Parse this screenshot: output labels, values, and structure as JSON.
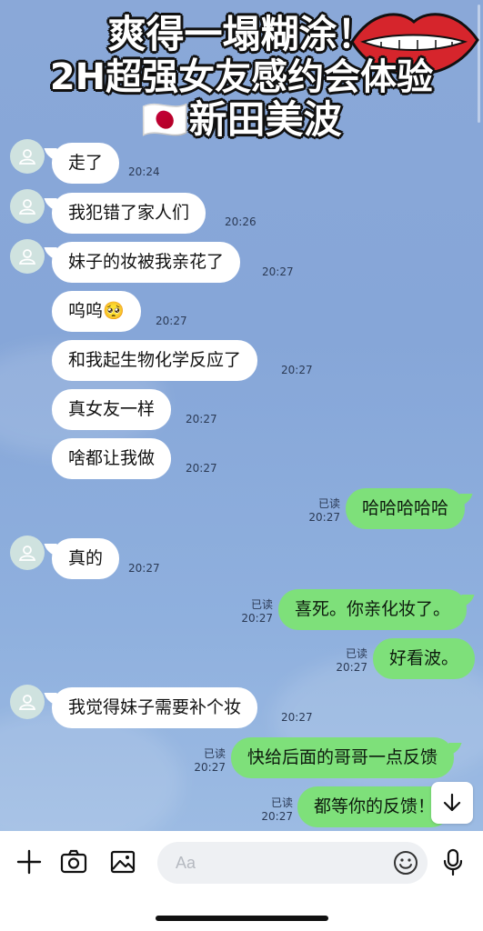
{
  "overlay": {
    "line1": "爽得一塌糊涂！",
    "line2": "2H超强女友感约会体验",
    "line3_flag": "🇯🇵",
    "line3": "新田美波"
  },
  "messages": [
    {
      "side": "in",
      "text": "走了",
      "time": "20:24"
    },
    {
      "side": "in",
      "text": "我犯错了家人们",
      "time": "20:26"
    },
    {
      "side": "in",
      "text": "妹子的妆被我亲花了",
      "time": "20:27"
    },
    {
      "side": "in",
      "text": "呜呜🥺",
      "time": "20:27"
    },
    {
      "side": "in",
      "text": "和我起生物化学反应了",
      "time": "20:27"
    },
    {
      "side": "in",
      "text": "真女友一样",
      "time": "20:27"
    },
    {
      "side": "in",
      "text": "啥都让我做",
      "time": "20:27"
    },
    {
      "side": "out",
      "text": "哈哈哈哈哈",
      "time": "20:27",
      "read": "已读"
    },
    {
      "side": "in",
      "text": "真的",
      "time": "20:27"
    },
    {
      "side": "out",
      "text": "喜死。你亲化妆了。",
      "time": "20:27",
      "read": "已读"
    },
    {
      "side": "out",
      "text": "好看波。",
      "time": "20:27",
      "read": "已读"
    },
    {
      "side": "in",
      "text": "我觉得妹子需要补个妆",
      "time": "20:27"
    },
    {
      "side": "out",
      "text": "快给后面的哥哥一点反馈",
      "time": "20:27",
      "read": "已读"
    },
    {
      "side": "out",
      "text": "都等你的反馈！",
      "time": "20:27",
      "read": "已读"
    }
  ],
  "input": {
    "placeholder": "Aa"
  },
  "colors": {
    "chat_bg": "#8aa8d8",
    "incoming_bubble": "#ffffff",
    "outgoing_bubble": "#7ee07a",
    "avatar_bg": "#cfe2df"
  },
  "icons": {
    "plus": "plus-icon",
    "camera": "camera-icon",
    "image": "image-icon",
    "emoji": "emoji-icon",
    "mic": "microphone-icon",
    "scroll_down": "arrow-down-icon"
  }
}
